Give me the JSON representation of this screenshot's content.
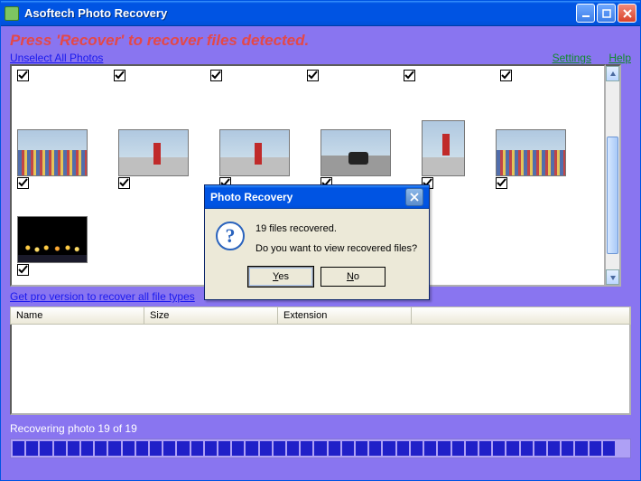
{
  "titlebar": {
    "title": "Asoftech Photo Recovery"
  },
  "instruction": "Press 'Recover' to recover files detected.",
  "links": {
    "unselect": "Unselect All Photos",
    "settings": "Settings",
    "help": "Help",
    "pro": "Get pro version to recover all file types"
  },
  "table": {
    "cols": [
      "Name",
      "Size",
      "Extension"
    ]
  },
  "status": "Recovering photo 19 of 19",
  "progress": {
    "filled": 44,
    "total": 45
  },
  "dialog": {
    "title": "Photo Recovery",
    "line1": "19 files recovered.",
    "line2": "Do you want to view recovered files?",
    "yes": "Yes",
    "no": "No"
  }
}
